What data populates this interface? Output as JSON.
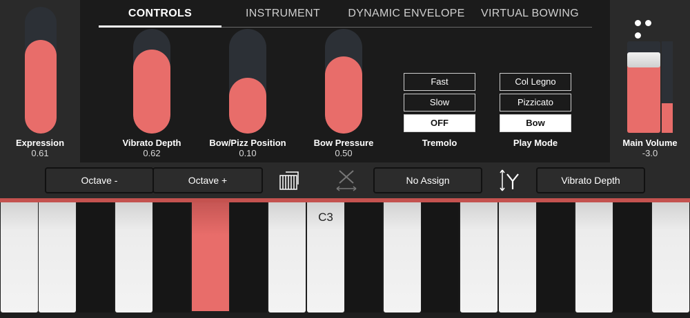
{
  "tabs": [
    {
      "label": "CONTROLS",
      "active": true
    },
    {
      "label": "INSTRUMENT",
      "active": false
    },
    {
      "label": "DYNAMIC ENVELOPE",
      "active": false
    },
    {
      "label": "VIRTUAL BOWING",
      "active": false
    }
  ],
  "controls": {
    "expression": {
      "label": "Expression",
      "value": "0.61",
      "level": 0.61
    },
    "vibrato_depth": {
      "label": "Vibrato Depth",
      "value": "0.62",
      "level": 0.62
    },
    "bow_pizz_position": {
      "label": "Bow/Pizz Position",
      "value": "0.10",
      "level": 0.1
    },
    "bow_pressure": {
      "label": "Bow Pressure",
      "value": "0.50",
      "level": 0.5
    }
  },
  "tremolo": {
    "label": "Tremolo",
    "options": [
      "Fast",
      "Slow",
      "OFF"
    ],
    "selected": "OFF"
  },
  "play_mode": {
    "label": "Play Mode",
    "options": [
      "Col Legno",
      "Pizzicato",
      "Bow"
    ],
    "selected": "Bow"
  },
  "main_volume": {
    "label": "Main Volume",
    "value": "-3.0",
    "level": 0.86,
    "meter_level": 0.32
  },
  "toolbar": {
    "octave_down": "Octave -",
    "octave_up": "Octave +",
    "x_assign": "No Assign",
    "y_assign": "Vibrato Depth"
  },
  "keyboard": {
    "note_label": "C3",
    "pressed_key": "black-key-3"
  },
  "colors": {
    "accent": "#e86d6a",
    "track": "#2c3036",
    "panel": "#2a2a2a",
    "background": "#1b1b1b"
  },
  "icons": {
    "more": "more-dots-icon",
    "keyboard": "keyboard-icon",
    "x_axis": "x-axis-icon",
    "y_axis": "y-axis-icon"
  }
}
